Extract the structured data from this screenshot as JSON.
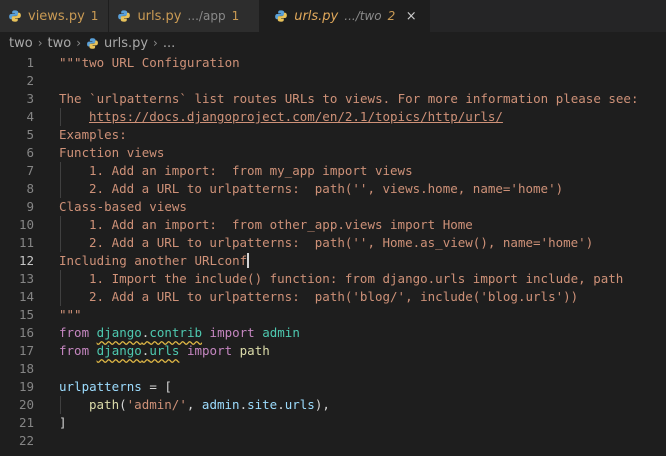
{
  "tabs": [
    {
      "name": "views.py",
      "dir": "",
      "count": "1",
      "active": false
    },
    {
      "name": "urls.py",
      "dir": ".../app",
      "count": "1",
      "active": false
    },
    {
      "name": "urls.py",
      "dir": ".../two",
      "count": "2",
      "active": true,
      "close": "×"
    }
  ],
  "breadcrumb": {
    "parts": [
      "two",
      "two"
    ],
    "file": "urls.py",
    "tail": "..."
  },
  "lines": {
    "l1": "\"\"\"two URL Configuration",
    "l3": "The `urlpatterns` list routes URLs to views. For more information please see:",
    "l4": "https://docs.djangoproject.com/en/2.1/topics/http/urls/",
    "l5": "Examples:",
    "l6": "Function views",
    "l7": "1. Add an import:  from my_app import views",
    "l8": "2. Add a URL to urlpatterns:  path('', views.home, name='home')",
    "l9": "Class-based views",
    "l10": "1. Add an import:  from other_app.views import Home",
    "l11": "2. Add a URL to urlpatterns:  path('', Home.as_view(), name='home')",
    "l12": "Including another URLconf",
    "l13": "1. Import the include() function: from django.urls import include, path",
    "l14": "2. Add a URL to urlpatterns:  path('blog/', include('blog.urls'))",
    "l15": "\"\"\"",
    "l16": {
      "kw1": "from",
      "mod1": "django",
      "dot": ".",
      "mod2": "contrib",
      "kw2": "import",
      "name": "admin"
    },
    "l17": {
      "kw1": "from",
      "mod1": "django",
      "dot": ".",
      "mod2": "urls",
      "kw2": "import",
      "name": "path"
    },
    "l19": {
      "var": "urlpatterns",
      "op": " = ["
    },
    "l20": {
      "fn": "path",
      "open": "(",
      "str": "'admin/'",
      "comma": ", ",
      "v1": "admin",
      "d1": ".",
      "v2": "site",
      "d2": ".",
      "v3": "urls",
      "close": "),"
    },
    "l21": "]"
  },
  "line_numbers": [
    "1",
    "2",
    "3",
    "4",
    "5",
    "6",
    "7",
    "8",
    "9",
    "10",
    "11",
    "12",
    "13",
    "14",
    "15",
    "16",
    "17",
    "18",
    "19",
    "20",
    "21",
    "22"
  ],
  "current_line": "12",
  "colors": {
    "string": "#ce9178",
    "keyword": "#c586c0",
    "module": "#4ec9b0",
    "variable": "#9cdcfe",
    "function": "#dcdcaa",
    "tab_name": "#e0a85b"
  },
  "icons": {
    "python_file": "python-icon",
    "chevron": "chevron-right-icon",
    "close": "close-icon"
  }
}
